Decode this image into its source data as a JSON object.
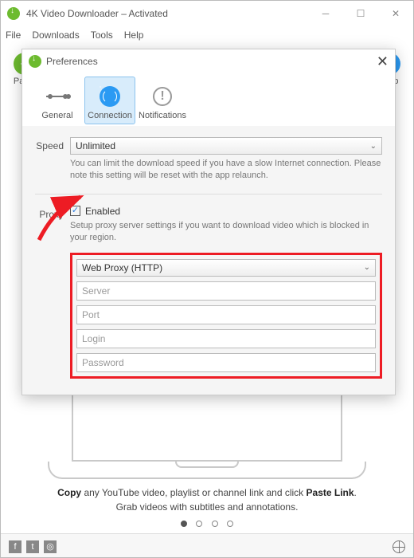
{
  "window": {
    "title": "4K Video Downloader – Activated"
  },
  "menu": {
    "file": "File",
    "downloads": "Downloads",
    "tools": "Tools",
    "help": "Help"
  },
  "toolbar": {
    "paste": "Paste",
    "help": "Help"
  },
  "instructions": {
    "line1_a": "Copy",
    "line1_b": " any YouTube video, playlist or channel link and click ",
    "line1_c": "Paste Link",
    "line1_d": ".",
    "line2": "Grab videos with subtitles and annotations."
  },
  "modal": {
    "title": "Preferences",
    "tabs": {
      "general": "General",
      "connection": "Connection",
      "notifications": "Notifications"
    },
    "speed": {
      "label": "Speed",
      "value": "Unlimited",
      "hint": "You can limit the download speed if you have a slow Internet connection. Please note this setting will be reset with the app relaunch."
    },
    "proxy": {
      "label": "Proxy",
      "enabled_label": "Enabled",
      "enabled": true,
      "hint": "Setup proxy server settings if you want to download video which is blocked in your region.",
      "type": "Web Proxy (HTTP)",
      "fields": {
        "server": "Server",
        "port": "Port",
        "login": "Login",
        "password": "Password"
      }
    }
  },
  "colors": {
    "highlight": "#ed1c24",
    "green": "#6dbb2f",
    "blue": "#2b9af3"
  }
}
